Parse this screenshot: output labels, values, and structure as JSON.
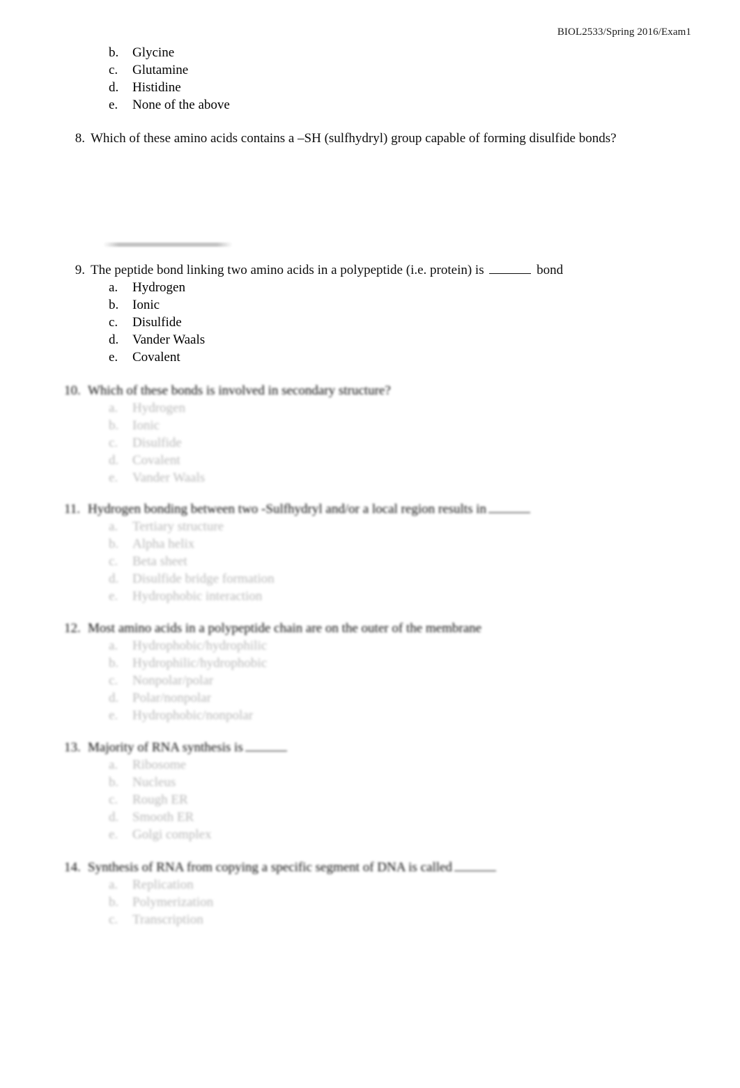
{
  "header": {
    "course_code": "BIOL2533/Spring 2016/Exam1"
  },
  "q7_tail": {
    "choices": [
      {
        "letter": "b.",
        "text": "Glycine"
      },
      {
        "letter": "c.",
        "text": "Glutamine"
      },
      {
        "letter": "d.",
        "text": "Histidine"
      },
      {
        "letter": "e.",
        "text": "None of the above"
      }
    ]
  },
  "q8": {
    "number": "8.",
    "text": "Which of these amino acids contains a –SH (sulfhydryl) group capable of forming disulfide bonds?"
  },
  "q9": {
    "number": "9.",
    "text_before_blank": "The peptide bond linking two amino acids in a polypeptide (i.e. protein) is ",
    "text_after_blank": " bond",
    "choices": [
      {
        "letter": "a.",
        "text": "Hydrogen"
      },
      {
        "letter": "b.",
        "text": "Ionic"
      },
      {
        "letter": "c.",
        "text": "Disulfide"
      },
      {
        "letter": "d.",
        "text": "Vander Waals"
      },
      {
        "letter": "e.",
        "text": "Covalent"
      }
    ]
  },
  "q10": {
    "number": "10.",
    "text": "Which of these bonds is involved in secondary structure?",
    "choices": [
      {
        "letter": "a.",
        "text": "Hydrogen"
      },
      {
        "letter": "b.",
        "text": "Ionic"
      },
      {
        "letter": "c.",
        "text": "Disulfide"
      },
      {
        "letter": "d.",
        "text": "Covalent"
      },
      {
        "letter": "e.",
        "text": "Vander Waals"
      }
    ]
  },
  "q11": {
    "number": "11.",
    "text": "Hydrogen bonding between two -Sulfhydryl and/or a local region results in",
    "choices": [
      {
        "letter": "a.",
        "text": "Tertiary structure"
      },
      {
        "letter": "b.",
        "text": "Alpha helix"
      },
      {
        "letter": "c.",
        "text": "Beta sheet"
      },
      {
        "letter": "d.",
        "text": "Disulfide bridge formation"
      },
      {
        "letter": "e.",
        "text": "Hydrophobic interaction"
      }
    ]
  },
  "q12": {
    "number": "12.",
    "text": "Most amino acids in a polypeptide chain are on the outer of the membrane",
    "choices": [
      {
        "letter": "a.",
        "text": "Hydrophobic/hydrophilic"
      },
      {
        "letter": "b.",
        "text": "Hydrophilic/hydrophobic"
      },
      {
        "letter": "c.",
        "text": "Nonpolar/polar"
      },
      {
        "letter": "d.",
        "text": "Polar/nonpolar"
      },
      {
        "letter": "e.",
        "text": "Hydrophobic/nonpolar"
      }
    ]
  },
  "q13": {
    "number": "13.",
    "text": "Majority of RNA synthesis is",
    "choices": [
      {
        "letter": "a.",
        "text": "Ribosome"
      },
      {
        "letter": "b.",
        "text": "Nucleus"
      },
      {
        "letter": "c.",
        "text": "Rough ER"
      },
      {
        "letter": "d.",
        "text": "Smooth ER"
      },
      {
        "letter": "e.",
        "text": "Golgi complex"
      }
    ]
  },
  "q14": {
    "number": "14.",
    "text": "Synthesis of RNA from copying a specific segment of DNA is called",
    "choices": [
      {
        "letter": "a.",
        "text": "Replication"
      },
      {
        "letter": "b.",
        "text": "Polymerization"
      },
      {
        "letter": "c.",
        "text": "Transcription"
      }
    ]
  }
}
